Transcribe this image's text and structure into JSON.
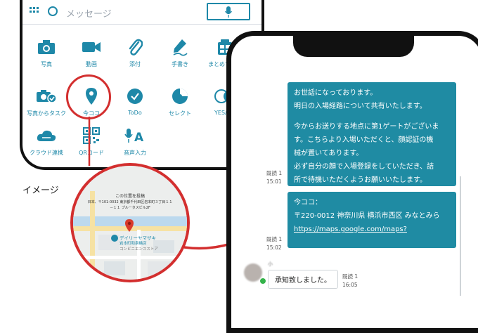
{
  "compose": {
    "placeholder": "メッセージ"
  },
  "menu_items": [
    {
      "label": "写真",
      "icon": "camera-icon"
    },
    {
      "label": "動画",
      "icon": "video-icon"
    },
    {
      "label": "添付",
      "icon": "paperclip-icon"
    },
    {
      "label": "手書き",
      "icon": "pen-icon"
    },
    {
      "label": "まとめて送信",
      "icon": "batch-send-icon"
    },
    {
      "label": "写真からタスク",
      "icon": "photo-task-icon"
    },
    {
      "label": "今ココ",
      "icon": "location-pin-icon"
    },
    {
      "label": "ToDo",
      "icon": "todo-check-icon"
    },
    {
      "label": "セレクト",
      "icon": "select-icon"
    },
    {
      "label": "YES/NO",
      "icon": "yes-no-icon"
    },
    {
      "label": "クラウド連携",
      "icon": "cloud-icon"
    },
    {
      "label": "QRコード",
      "icon": "qr-code-icon"
    },
    {
      "label": "音声入力",
      "icon": "voice-input-icon"
    }
  ],
  "image_label": "イメージ",
  "map_popup": {
    "title": "この位置を投稿",
    "address_line1": "日本、〒101-0032 東京都千代田区岩本町３丁目１１",
    "address_line2": "－１１ プルータスビル2F",
    "poi_name": "デイリーヤマザキ",
    "poi_sub1": "岩本町和泉橋店",
    "poi_sub2": "コンビニエンスストア"
  },
  "chat": {
    "message1": {
      "lines": [
        "お世話になっております。",
        "明日の入場経路について共有いたします。",
        "",
        "今からお送りする地点に第1ゲートがございま",
        "す。こちらより入場いただくと、顔認証の機",
        "械が置いてあります。",
        "必ず自分の顔で入場登録をしていただき、詰",
        "所で待機いただくようお願いいたします。"
      ],
      "read_label": "既読 1",
      "time": "15:01"
    },
    "message2": {
      "heading": "今ココ：",
      "address": "〒220-0012 神奈川県 横浜市西区 みなとみら",
      "url": "https://maps.google.com/maps?",
      "read_label": "既読 1",
      "time": "15:02"
    },
    "reply": {
      "sender": "小",
      "text": "承知致しました。",
      "read_label": "既読 1",
      "time": "16:05"
    }
  },
  "colors": {
    "accent": "#1e88a8",
    "bubble": "#1f8ba3",
    "highlight": "#d32f2f"
  }
}
